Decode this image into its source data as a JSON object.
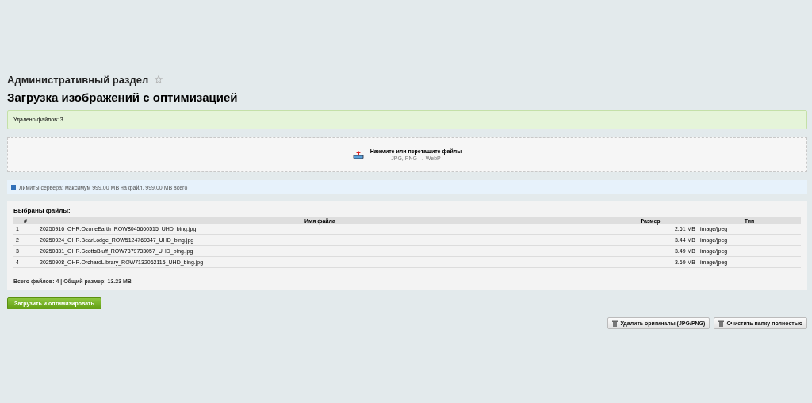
{
  "breadcrumb": {
    "title": "Административный раздел",
    "favorite": false
  },
  "page_title": "Загрузка изображений с оптимизацией",
  "success_message": "Удалено файлов: 3",
  "dropzone": {
    "label": "Нажмите или перетащите файлы",
    "hint": "JPG, PNG → WebP"
  },
  "info_message": "Лимиты сервера: максимум 999.00 MB на файл, 999.00 MB всего",
  "files_panel": {
    "title": "Выбраны файлы:",
    "columns": [
      "#",
      "Имя файла",
      "Размер",
      "Тип"
    ],
    "rows": [
      {
        "index": "1",
        "name": "20250916_OHR.OzoneEarth_ROW8045660515_UHD_bing.jpg",
        "size": "2.61 MB",
        "type": "image/jpeg"
      },
      {
        "index": "2",
        "name": "20250924_OHR.BearLodge_ROW5124769347_UHD_bing.jpg",
        "size": "3.44 MB",
        "type": "image/jpeg"
      },
      {
        "index": "3",
        "name": "20250831_OHR.ScottsBluff_ROW7379733057_UHD_bing.jpg",
        "size": "3.49 MB",
        "type": "image/jpeg"
      },
      {
        "index": "4",
        "name": "20250908_OHR.OrchardLibrary_ROW7132062115_UHD_bing.jpg",
        "size": "3.69 MB",
        "type": "image/jpeg"
      }
    ],
    "summary": "Всего файлов: 4 | Общий размер: 13.23 MB"
  },
  "upload_button": "Загрузить и оптимизировать",
  "actions": [
    "Удалить оригиналы (JPG/PNG)",
    "Очистить папку полностью"
  ]
}
